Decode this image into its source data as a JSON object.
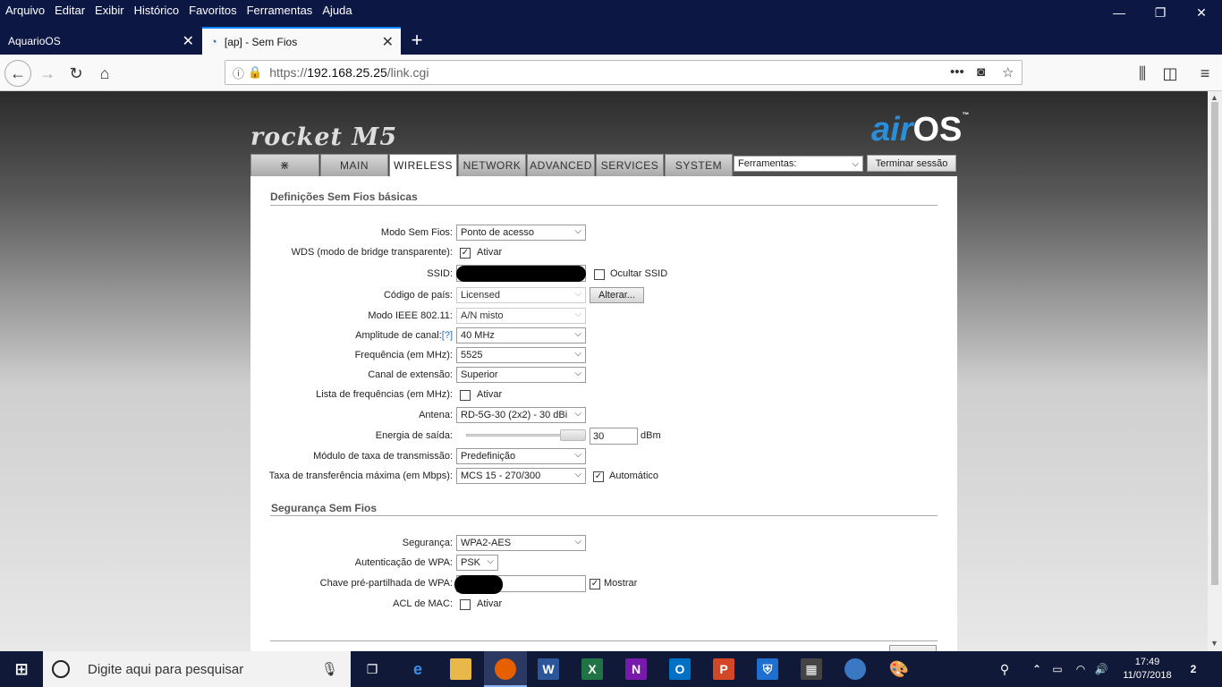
{
  "browser": {
    "menu": [
      "Arquivo",
      "Editar",
      "Exibir",
      "Histórico",
      "Favoritos",
      "Ferramentas",
      "Ajuda"
    ],
    "tabs": [
      {
        "title": "AquarioOS"
      },
      {
        "title": "[ap] - Sem Fios"
      }
    ],
    "url_prefix": "https://",
    "url_host": "192.168.25.25",
    "url_path": "/link.cgi"
  },
  "airos": {
    "product": "rocket M5",
    "brand_air": "air",
    "brand_os": "OS",
    "brand_tm": "™",
    "tabs": [
      "MAIN",
      "WIRELESS",
      "NETWORK",
      "ADVANCED",
      "SERVICES",
      "SYSTEM"
    ],
    "active_tab": "WIRELESS",
    "tools_select": "Ferramentas:",
    "logout": "Terminar sessão"
  },
  "wireless_basic": {
    "heading": "Definições Sem Fios básicas",
    "mode_label": "Modo Sem Fios:",
    "mode_value": "Ponto de acesso",
    "wds_label": "WDS (modo de bridge transparente):",
    "wds_option": "Ativar",
    "wds_checked": true,
    "ssid_label": "SSID:",
    "hide_ssid": "Ocultar SSID",
    "hide_ssid_checked": false,
    "country_label": "Código de país:",
    "country_value": "Licensed",
    "change_button": "Alterar...",
    "ieee_label": "Modo IEEE 802.11:",
    "ieee_value": "A/N misto",
    "width_label": "Amplitude de canal:",
    "width_help": "[?]",
    "width_value": "40 MHz",
    "freq_label": "Frequência (em MHz):",
    "freq_value": "5525",
    "ext_label": "Canal de extensão:",
    "ext_value": "Superior",
    "freqlist_label": "Lista de frequências (em MHz):",
    "freqlist_option": "Ativar",
    "freqlist_checked": false,
    "antenna_label": "Antena:",
    "antenna_value": "RD-5G-30 (2x2) - 30 dBi",
    "power_label": "Energia de saída:",
    "power_value": "30",
    "power_unit": "dBm",
    "power_level": 1.0,
    "rate_module_label": "Módulo de taxa de transmissão:",
    "rate_module_value": "Predefinição",
    "max_rate_label": "Taxa de transferência máxima (em Mbps):",
    "max_rate_value": "MCS 15 - 270/300",
    "auto_option": "Automático",
    "auto_checked": true
  },
  "wireless_security": {
    "heading": "Segurança Sem Fios",
    "security_label": "Segurança:",
    "security_value": "WPA2-AES",
    "wpa_auth_label": "Autenticação de WPA:",
    "wpa_auth_value": "PSK",
    "psk_label": "Chave pré-partilhada de WPA:",
    "show_option": "Mostrar",
    "show_checked": true,
    "acl_label": "ACL de MAC:",
    "acl_option": "Ativar",
    "acl_checked": false
  },
  "taskbar": {
    "search_placeholder": "Digite aqui para pesquisar",
    "time": "17:49",
    "date": "11/07/2018",
    "notifications": "2"
  }
}
